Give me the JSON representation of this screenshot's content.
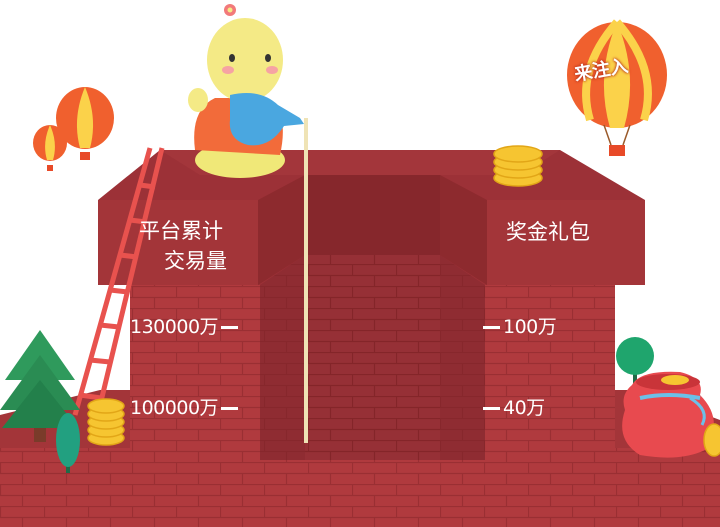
{
  "balloon_text": "来注入",
  "left_header": {
    "line1": "平台累计",
    "line2": "交易量"
  },
  "right_header": "奖金礼包",
  "levels": [
    {
      "volume": "130000万",
      "bonus": "100万"
    },
    {
      "volume": "100000万",
      "bonus": "40万"
    }
  ],
  "colors": {
    "brick": "#b03a3e",
    "brick_dark": "#8d2a2e",
    "pit": "#9b3237",
    "coin": "#f6c531",
    "stream": "#efe3b5"
  }
}
